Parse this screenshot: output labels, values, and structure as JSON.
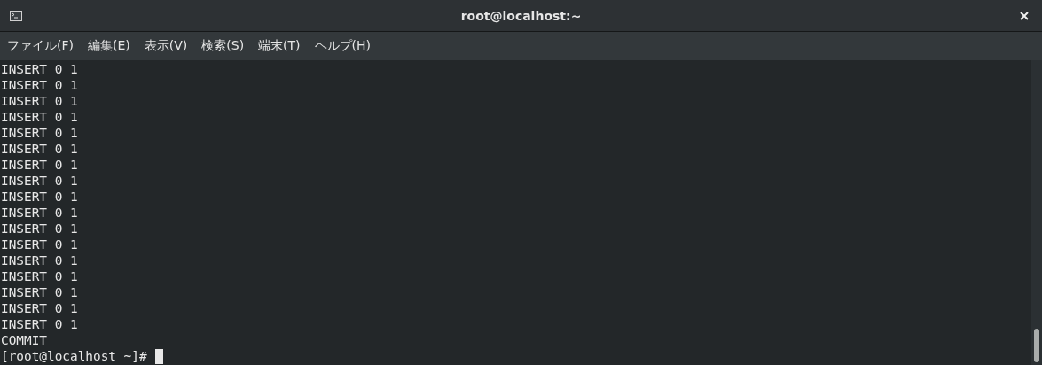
{
  "window": {
    "title": "root@localhost:~"
  },
  "menu": [
    {
      "label": "ファイル(F)"
    },
    {
      "label": "編集(E)"
    },
    {
      "label": "表示(V)"
    },
    {
      "label": "検索(S)"
    },
    {
      "label": "端末(T)"
    },
    {
      "label": "ヘルプ(H)"
    }
  ],
  "terminal": {
    "lines": [
      "INSERT 0 1",
      "INSERT 0 1",
      "INSERT 0 1",
      "INSERT 0 1",
      "INSERT 0 1",
      "INSERT 0 1",
      "INSERT 0 1",
      "INSERT 0 1",
      "INSERT 0 1",
      "INSERT 0 1",
      "INSERT 0 1",
      "INSERT 0 1",
      "INSERT 0 1",
      "INSERT 0 1",
      "INSERT 0 1",
      "INSERT 0 1",
      "INSERT 0 1",
      "COMMIT"
    ],
    "prompt": "[root@localhost ~]#"
  }
}
